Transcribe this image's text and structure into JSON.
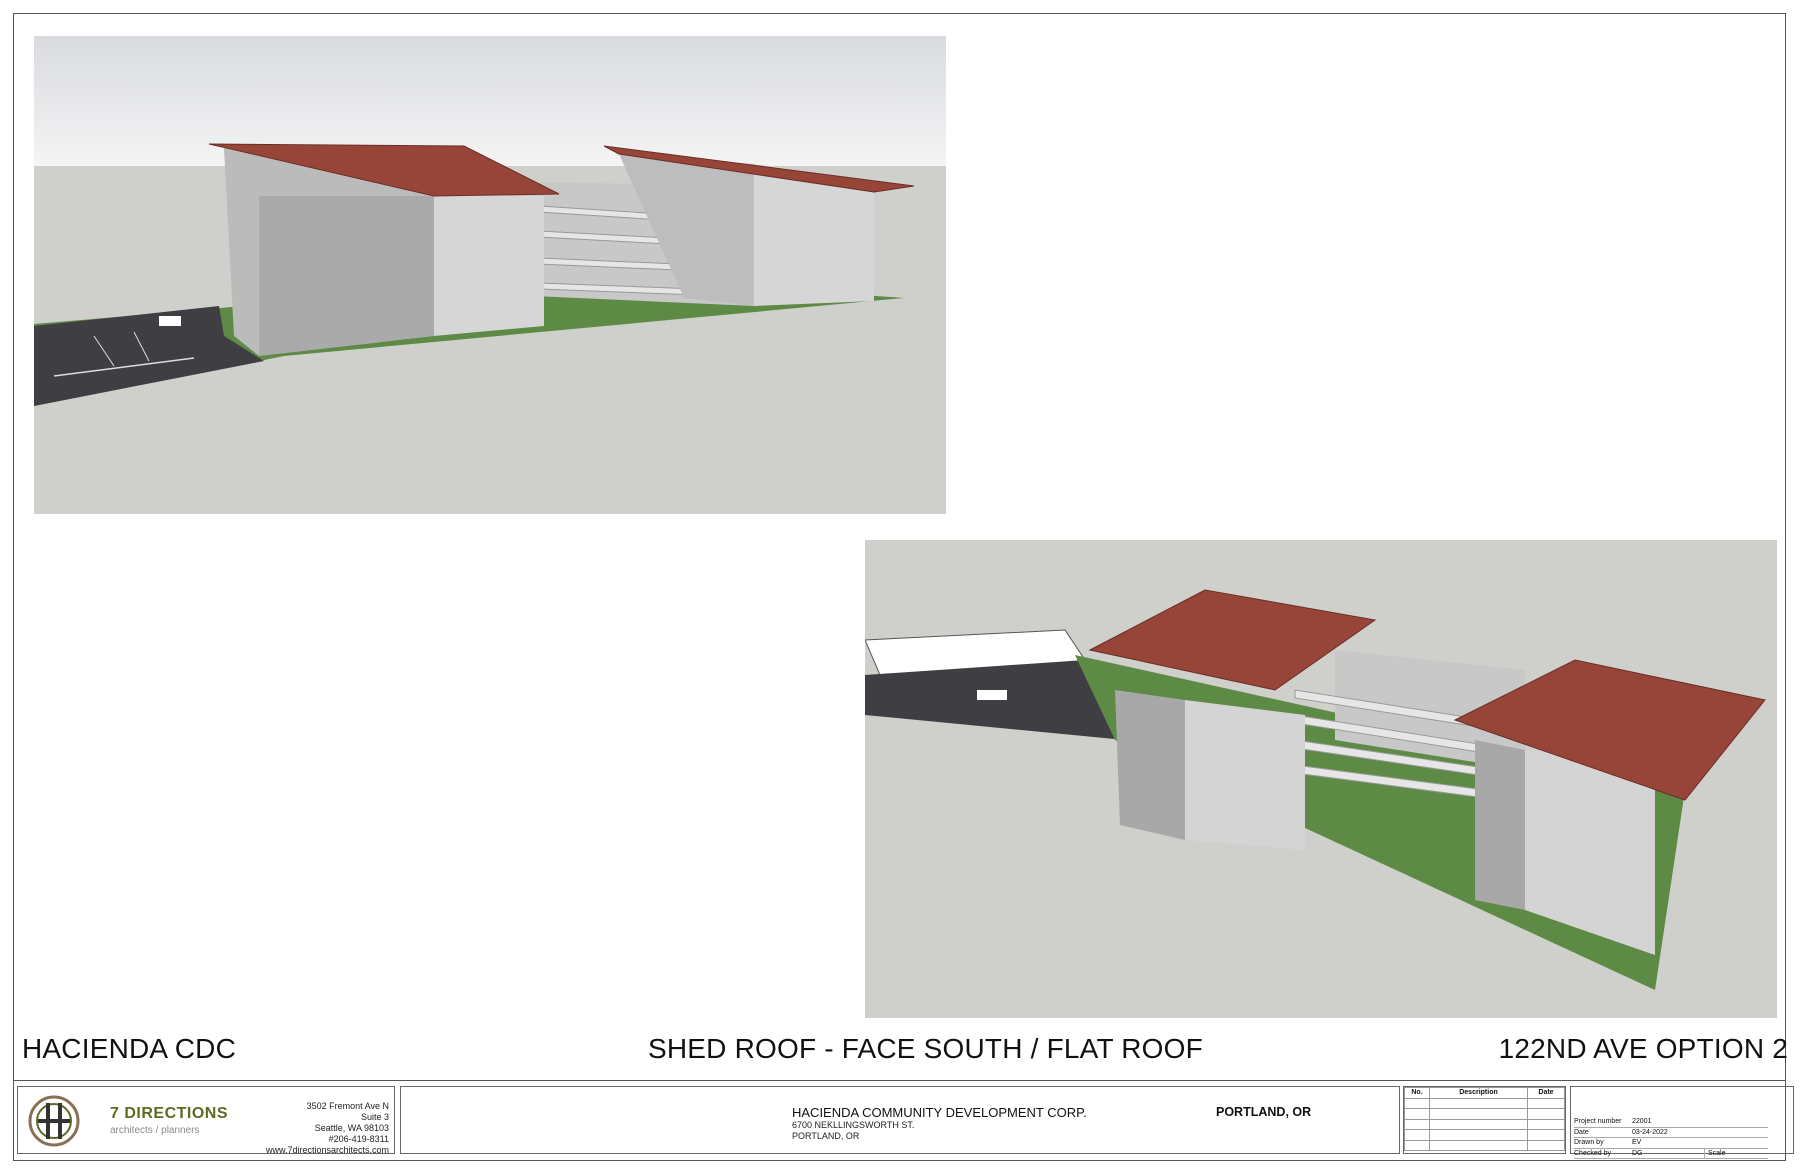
{
  "titles": {
    "client": "HACIENDA CDC",
    "sheet": "SHED ROOF - FACE SOUTH / FLAT ROOF",
    "option": "122ND AVE OPTION 2"
  },
  "firm": {
    "name": "7 DIRECTIONS",
    "tagline": "architects / planners",
    "address": [
      "3502 Fremont Ave N",
      "Suite 3",
      "Seattle, WA 98103",
      "#206-419-8311",
      "www.7directionsarchitects.com"
    ]
  },
  "client_block": {
    "name": "HACIENDA COMMUNITY DEVELOPMENT CORP.",
    "street": "6700 NEKLLINGSWORTH ST.",
    "city_line": "PORTLAND, OR",
    "location": "PORTLAND, OR"
  },
  "revisions": {
    "headers": [
      "No.",
      "Description",
      "Date"
    ]
  },
  "project": {
    "rows": [
      {
        "label": "Project number",
        "value": "22001"
      },
      {
        "label": "Date",
        "value": "03-24-2022"
      },
      {
        "label": "Drawn by",
        "value": "EV"
      },
      {
        "label": "Checked by",
        "value": "DG",
        "extra": "Scale"
      }
    ]
  },
  "colors": {
    "roof": "#974538",
    "wall": "#d8d8d8",
    "grass": "#5d8a45",
    "asphalt": "#3f3f43",
    "ground": "#cfcfcb",
    "sky_top": "#cfd2d6",
    "accent": "#5b6b1f"
  }
}
